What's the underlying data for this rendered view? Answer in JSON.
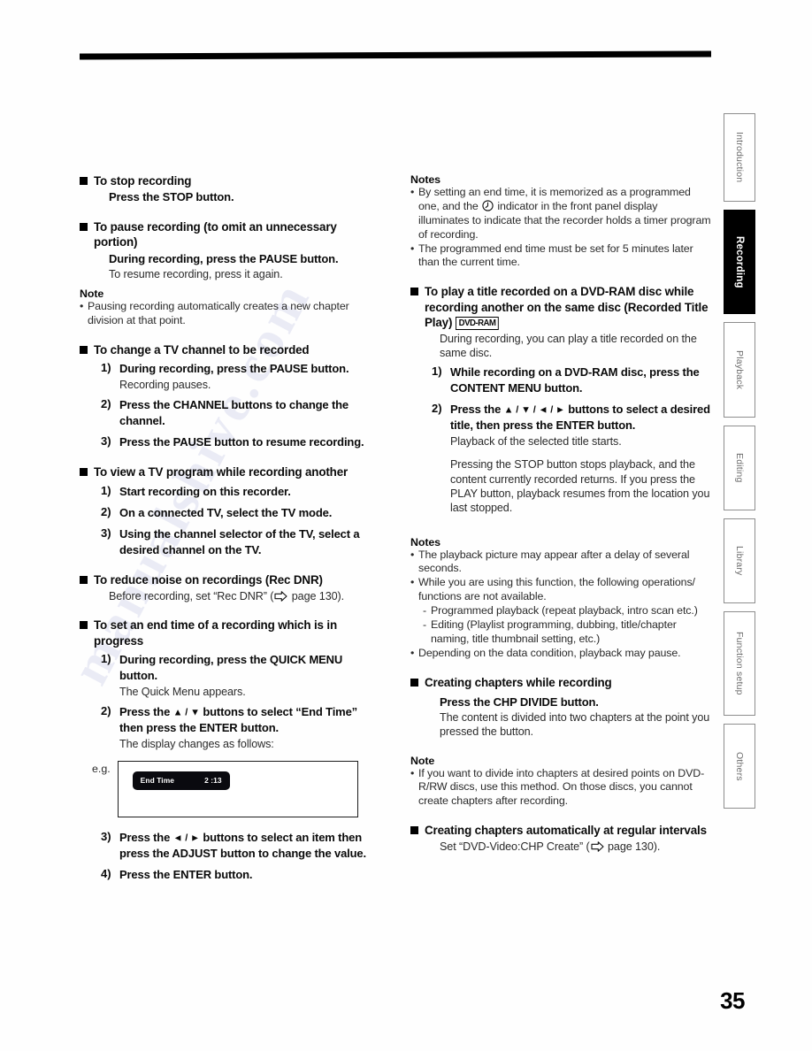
{
  "page": {
    "number": "35",
    "watermark_text": "manualshive.com"
  },
  "tabs": [
    {
      "label": "Introduction",
      "active": false
    },
    {
      "label": "Recording",
      "active": true
    },
    {
      "label": "Playback",
      "active": false
    },
    {
      "label": "Editing",
      "active": false
    },
    {
      "label": "Library",
      "active": false
    },
    {
      "label": "Function setup",
      "active": false
    },
    {
      "label": "Others",
      "active": false
    }
  ],
  "left_column": {
    "s1": {
      "heading": "To stop recording",
      "bold_line": "Press the STOP button."
    },
    "s2": {
      "heading": "To pause recording (to omit an unnecessary portion)",
      "bold_line": "During recording, press the PAUSE button.",
      "plain_line": "To resume recording, press it again.",
      "note_head": "Note",
      "note_1": "Pausing recording automatically creates a new chapter division at that point."
    },
    "s3": {
      "heading": "To change a TV channel to be recorded",
      "step1_num": "1)",
      "step1_bold": "During recording, press the PAUSE button.",
      "step1_plain": "Recording pauses.",
      "step2_num": "2)",
      "step2_bold": "Press the CHANNEL buttons to change the channel.",
      "step3_num": "3)",
      "step3_bold": "Press the PAUSE button to resume recording."
    },
    "s4": {
      "heading": "To view a TV program while recording another",
      "step1_num": "1)",
      "step1_bold": "Start recording on this recorder.",
      "step2_num": "2)",
      "step2_bold": "On a connected TV, select the TV mode.",
      "step3_num": "3)",
      "step3_bold": "Using the channel selector of the TV, select a desired channel on the TV."
    },
    "s5": {
      "heading": "To reduce noise on recordings (Rec DNR)",
      "plain_before": "Before recording, set “Rec DNR” (",
      "plain_after": " page 130)."
    },
    "s6": {
      "heading": "To set an end time of a recording which is in progress",
      "step1_num": "1)",
      "step1_bold": "During recording, press the QUICK MENU button.",
      "step1_plain": "The Quick Menu appears.",
      "step2_num": "2)",
      "step2_bold_a": "Press the ",
      "step2_bold_tri": "▲ / ▼",
      "step2_bold_b": " buttons to select “End Time” then press the ENTER button.",
      "step2_plain": "The display changes as follows:",
      "eg_label": "e.g.",
      "osd_item": "End Time",
      "osd_value": "2 :13",
      "step3_num": "3)",
      "step3_bold_a": "Press the ",
      "step3_bold_tri": "◄ / ►",
      "step3_bold_b": " buttons to select an item then press the ADJUST button to change the value.",
      "step4_num": "4)",
      "step4_bold": "Press the ENTER button."
    }
  },
  "right_column": {
    "notes1": {
      "head": "Notes",
      "n1_a": "By setting an end time, it is memorized as a programmed one, and the ",
      "n1_b": " indicator in the front panel display illuminates to indicate that the recorder holds a timer program of recording.",
      "n2": "The programmed end time must be set for 5 minutes later than the current time."
    },
    "s7": {
      "heading_a": "To play a title recorded on a DVD-RAM disc while recording another on the same disc (Recorded Title Play) ",
      "badge": "DVD-RAM",
      "plain": "During recording, you can play a title recorded on the same disc.",
      "step1_num": "1)",
      "step1_bold": "While recording on a DVD-RAM disc, press the CONTENT MENU button.",
      "step2_num": "2)",
      "step2_bold_a": "Press the ",
      "step2_bold_tri": "▲ / ▼ / ◄ / ►",
      "step2_bold_b": " buttons to select a desired title, then press the ENTER button.",
      "step2_plain": "Playback of the selected title starts.",
      "step2_plain2": "Pressing the STOP button stops playback, and the content currently recorded returns. If you press the PLAY button, playback resumes from the location you last stopped."
    },
    "notes2": {
      "head": "Notes",
      "n1": "The playback picture may appear after a delay of several seconds.",
      "n2": "While you are using this function, the following operations/ functions are not available.",
      "n2_sub1": "Programmed playback (repeat playback, intro scan etc.)",
      "n2_sub2": "Editing (Playlist programming, dubbing, title/chapter naming, title thumbnail setting, etc.)",
      "n3": "Depending on the data condition, playback may pause."
    },
    "s8": {
      "heading": "Creating chapters while recording",
      "bold_line": "Press the CHP DIVIDE button.",
      "plain_line": "The content is divided into two chapters at the point you pressed the button."
    },
    "note3": {
      "head": "Note",
      "n1": "If you want to divide into chapters at desired points on DVD-R/RW discs, use this method. On those discs, you cannot create chapters after recording."
    },
    "s9": {
      "heading": "Creating chapters automatically at regular intervals",
      "plain_before": "Set “DVD-Video:CHP Create” (",
      "plain_after": " page 130)."
    }
  }
}
